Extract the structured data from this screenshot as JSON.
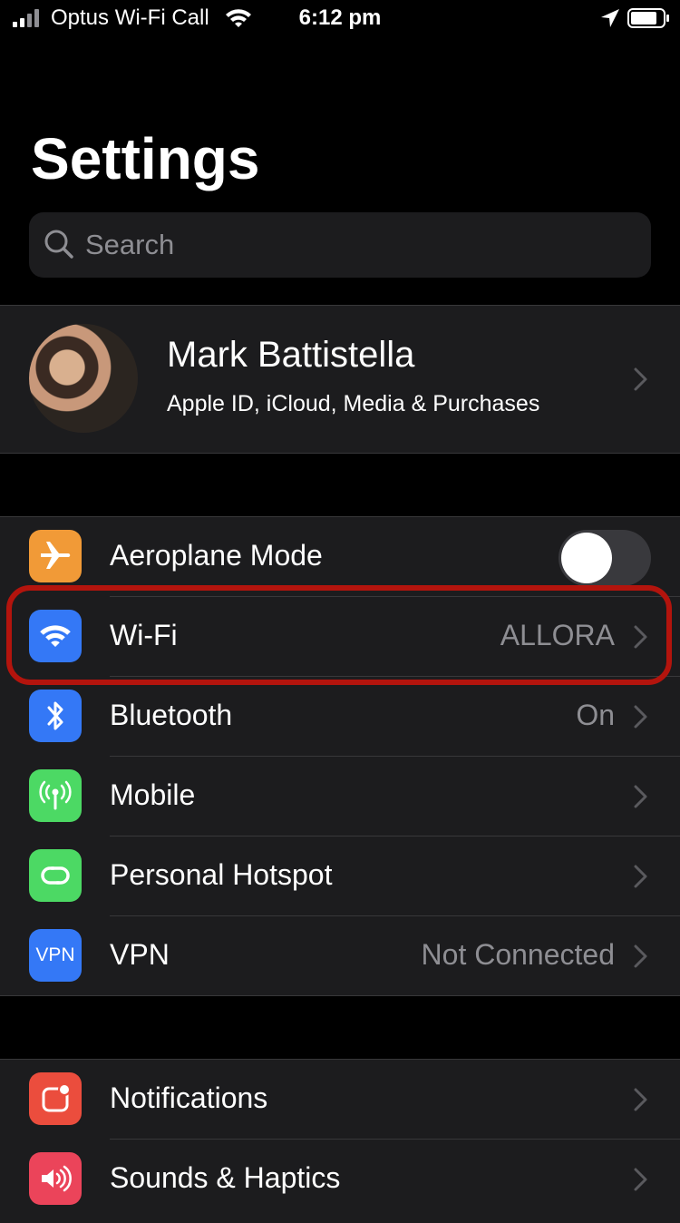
{
  "status_bar": {
    "carrier": "Optus Wi-Fi Call",
    "time": "6:12 pm"
  },
  "page": {
    "title": "Settings"
  },
  "search": {
    "placeholder": "Search"
  },
  "profile": {
    "name": "Mark Battistella",
    "subtitle": "Apple ID, iCloud, Media & Purchases"
  },
  "network_group": [
    {
      "label": "Aeroplane Mode",
      "value": "",
      "icon": "airplane-icon",
      "color": "#f19a37"
    },
    {
      "label": "Wi-Fi",
      "value": "ALLORA",
      "icon": "wifi-icon",
      "color": "#3478f6"
    },
    {
      "label": "Bluetooth",
      "value": "On",
      "icon": "bluetooth-icon",
      "color": "#3478f6"
    },
    {
      "label": "Mobile",
      "value": "",
      "icon": "antenna-icon",
      "color": "#4cd964"
    },
    {
      "label": "Personal Hotspot",
      "value": "",
      "icon": "hotspot-link-icon",
      "color": "#4cd964"
    },
    {
      "label": "VPN",
      "value": "Not Connected",
      "icon": "vpn-icon",
      "color": "#3478f6",
      "icon_text": "VPN"
    }
  ],
  "notifications_group": [
    {
      "label": "Notifications",
      "value": "",
      "icon": "notifications-icon",
      "color": "#eb4d3d"
    },
    {
      "label": "Sounds & Haptics",
      "value": "",
      "icon": "speaker-icon",
      "color": "#eb445a"
    }
  ],
  "aeroplane_toggle": {
    "on": false
  },
  "colors": {
    "background": "#000000",
    "cell": "#1c1c1e",
    "secondary_text": "#8e8e93",
    "highlight": "#b3140d"
  }
}
